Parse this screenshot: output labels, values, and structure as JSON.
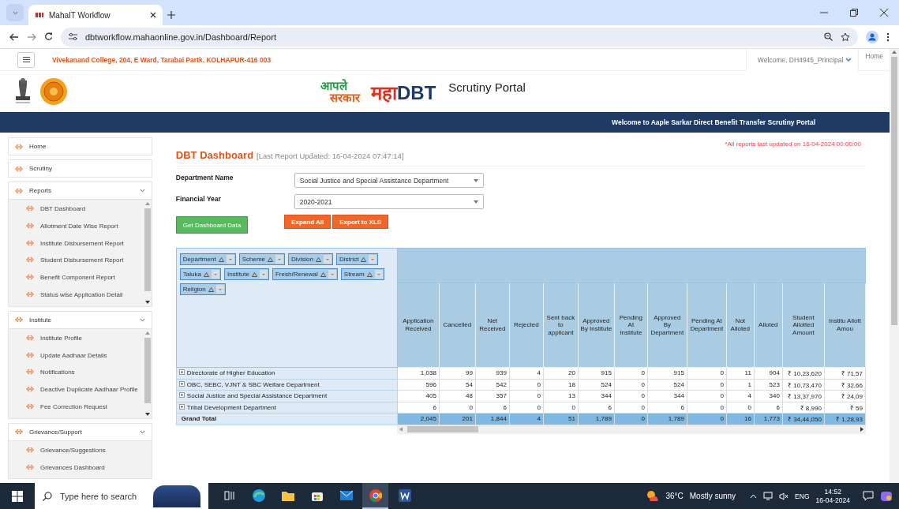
{
  "browser": {
    "tab_title": "MahaIT Workflow",
    "url": "dbtworkflow.mahaonline.gov.in/Dashboard/Report"
  },
  "topbar": {
    "institute": "Vivekanand College, 204, E Ward, Tarabai Partk, KOLHAPUR-416 003",
    "welcome": "Welcome, DH4945_Principal",
    "home": "Home"
  },
  "header": {
    "logo_line1": "आपले",
    "logo_line2": "सरकार",
    "brand_prefix": "महा",
    "brand_suffix": "DBT",
    "portal": "Scrutiny Portal"
  },
  "banner": "Welcome to Aaple Sarkar Direct Benefit Transfer Scrutiny Portal",
  "sidebar": [
    {
      "label": "Home",
      "kind": "link"
    },
    {
      "label": "Scrutiny",
      "kind": "link"
    },
    {
      "label": "Reports",
      "kind": "group",
      "children": [
        "DBT Dashboard",
        "Allotment Date Wise Report",
        "Institute Disbursement Report",
        "Student Disbursement Report",
        "Benefit Component Report",
        "Status wise Application Detail"
      ]
    },
    {
      "label": "Institute",
      "kind": "group",
      "children": [
        "Institute Profile",
        "Update Aadhaar Details",
        "Notifications",
        "Deactive Duplicate Aadhaar Profile",
        "Fee Correction Request"
      ]
    },
    {
      "label": "Grievance/Support",
      "kind": "group",
      "children": [
        "Grievance/Suggestions",
        "Grievances Dashboard"
      ]
    }
  ],
  "dashboard": {
    "title": "DBT Dashboard",
    "updated": "[Last Report Updated: 16-04-2024 07:47:14]",
    "notice": "*All reports last updated on 16-04-2024 00:00:00",
    "fields": [
      {
        "label": "Department Name",
        "value": "Social Justice and Special Assistance Department"
      },
      {
        "label": "Financial Year",
        "value": "2020-2021"
      }
    ],
    "buttons": [
      {
        "label": "Get Dashboard Data",
        "kind": "success"
      },
      {
        "label": "Expand All",
        "kind": "warning"
      },
      {
        "label": "Export to XLS",
        "kind": "warning"
      }
    ]
  },
  "pivot": {
    "fields": [
      "Department",
      "Scheme",
      "Division",
      "District",
      "Taluka",
      "Institute",
      "Fresh/Renewal",
      "Stream",
      "Religion"
    ],
    "columns": [
      "Application Received",
      "Cancelled",
      "Net Received",
      "Rejected",
      "Sent back to applicant",
      "Approved By Institute",
      "Pending At Institute",
      "Approved By Department",
      "Pending At Department",
      "Not Alloted",
      "Alloted",
      "Student Allotted Amount",
      "Institu Allott Amou"
    ],
    "rows": [
      {
        "label": "Directorate of Higher Education",
        "values": [
          "1,038",
          "99",
          "939",
          "4",
          "20",
          "915",
          "0",
          "915",
          "0",
          "11",
          "904",
          "₹ 10,23,620",
          "₹ 71,57"
        ]
      },
      {
        "label": "OBC, SEBC, VJNT & SBC Welfare Department",
        "values": [
          "596",
          "54",
          "542",
          "0",
          "18",
          "524",
          "0",
          "524",
          "0",
          "1",
          "523",
          "₹ 10,73,470",
          "₹ 32,66"
        ]
      },
      {
        "label": "Social Justice and Special Assistance Department",
        "values": [
          "405",
          "48",
          "357",
          "0",
          "13",
          "344",
          "0",
          "344",
          "0",
          "4",
          "340",
          "₹ 13,37,970",
          "₹ 24,09"
        ]
      },
      {
        "label": "Tribal Development Department",
        "values": [
          "6",
          "0",
          "6",
          "0",
          "0",
          "6",
          "0",
          "6",
          "0",
          "0",
          "6",
          "₹ 8,990",
          "₹ 59"
        ]
      }
    ],
    "total": {
      "label": "Grand Total",
      "values": [
        "2,045",
        "201",
        "1,844",
        "4",
        "51",
        "1,789",
        "0",
        "1,789",
        "0",
        "16",
        "1,773",
        "₹ 34,44,050",
        "₹ 1,28,93"
      ]
    }
  },
  "taskbar": {
    "search_placeholder": "Type here to search",
    "apps": [
      {
        "kind": "taskview",
        "active": false
      },
      {
        "kind": "edge",
        "active": false
      },
      {
        "kind": "explorer",
        "active": false
      },
      {
        "kind": "store",
        "active": false
      },
      {
        "kind": "mail",
        "active": false
      },
      {
        "kind": "chrome",
        "active": true
      },
      {
        "kind": "word",
        "active": false
      }
    ],
    "temperature": "36°C",
    "weather": "Mostly sunny",
    "language": "ENG",
    "time": "14:52",
    "date": "16-04-2024"
  }
}
